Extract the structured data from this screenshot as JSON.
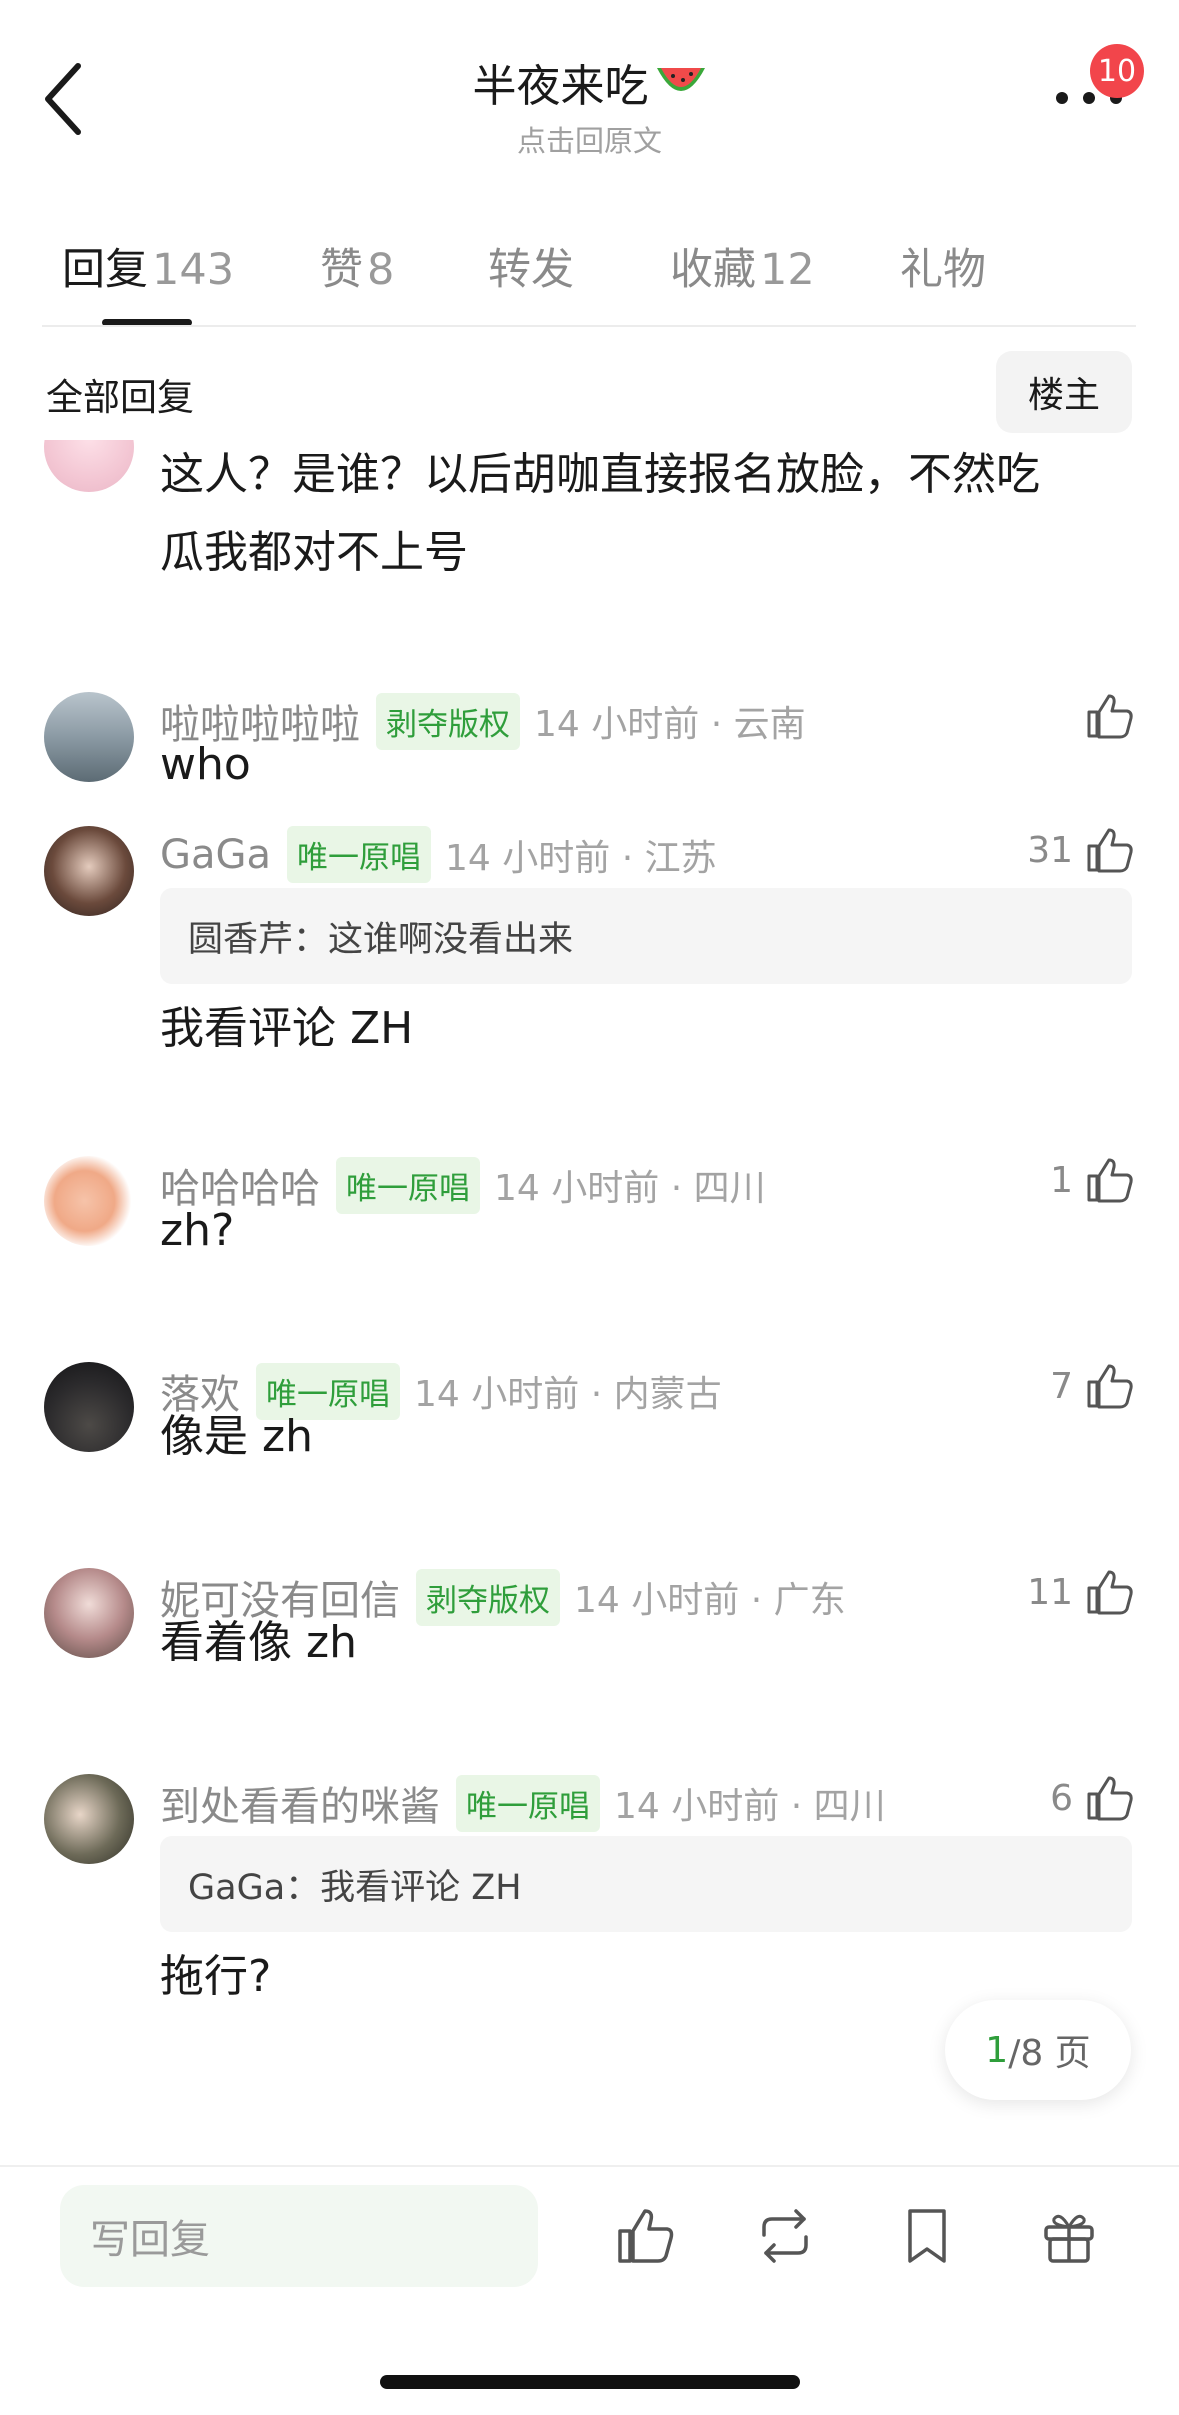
{
  "header": {
    "title": "半夜来吃",
    "subtitle": "点击回原文",
    "notification_count": "10",
    "title_emoji": "watermelon-icon"
  },
  "tabs": [
    {
      "label": "回复",
      "count": "143",
      "active": true
    },
    {
      "label": "赞",
      "count": "8",
      "active": false
    },
    {
      "label": "转发",
      "count": "",
      "active": false
    },
    {
      "label": "收藏",
      "count": "12",
      "active": false
    },
    {
      "label": "礼物",
      "count": "",
      "active": false
    }
  ],
  "filter": {
    "all_replies": "全部回复",
    "host_only": "楼主"
  },
  "comments": [
    {
      "name": "",
      "tag": "",
      "time": "",
      "likes": "",
      "quote": "",
      "text_lines": [
        "这人？是谁？以后胡咖直接报名放脸，不然吃",
        "瓜我都对不上号"
      ]
    },
    {
      "name": "啦啦啦啦啦",
      "tag": "剥夺版权",
      "time": "14 小时前 · 云南",
      "likes": "",
      "quote": "",
      "text_lines": [
        "who"
      ]
    },
    {
      "name": "GaGa",
      "tag": "唯一原唱",
      "time": "14 小时前 · 江苏",
      "likes": "31",
      "quote": "圆香芹：这谁啊没看出来",
      "text_lines": [
        "我看评论 ZH"
      ]
    },
    {
      "name": "哈哈哈哈",
      "tag": "唯一原唱",
      "time": "14 小时前 · 四川",
      "likes": "1",
      "quote": "",
      "text_lines": [
        "zh?"
      ]
    },
    {
      "name": "落欢",
      "tag": "唯一原唱",
      "time": "14 小时前 · 内蒙古",
      "likes": "7",
      "quote": "",
      "text_lines": [
        "像是 zh"
      ]
    },
    {
      "name": "妮可没有回信",
      "tag": "剥夺版权",
      "time": "14 小时前 · 广东",
      "likes": "11",
      "quote": "",
      "text_lines": [
        "看着像 zh"
      ]
    },
    {
      "name": "到处看看的咪酱",
      "tag": "唯一原唱",
      "time": "14 小时前 · 四川",
      "likes": "6",
      "quote": "GaGa：我看评论 ZH",
      "text_lines": [
        "拖行?"
      ]
    }
  ],
  "pager": {
    "current": "1",
    "total_text": "/8 页"
  },
  "bottom_bar": {
    "reply_placeholder": "写回复",
    "icons": [
      "like-icon",
      "repost-icon",
      "bookmark-icon",
      "gift-icon"
    ]
  },
  "colors": {
    "accent_green": "#2f9e3b",
    "tag_bg": "#e9f6e6",
    "badge_red": "#f2454b"
  }
}
